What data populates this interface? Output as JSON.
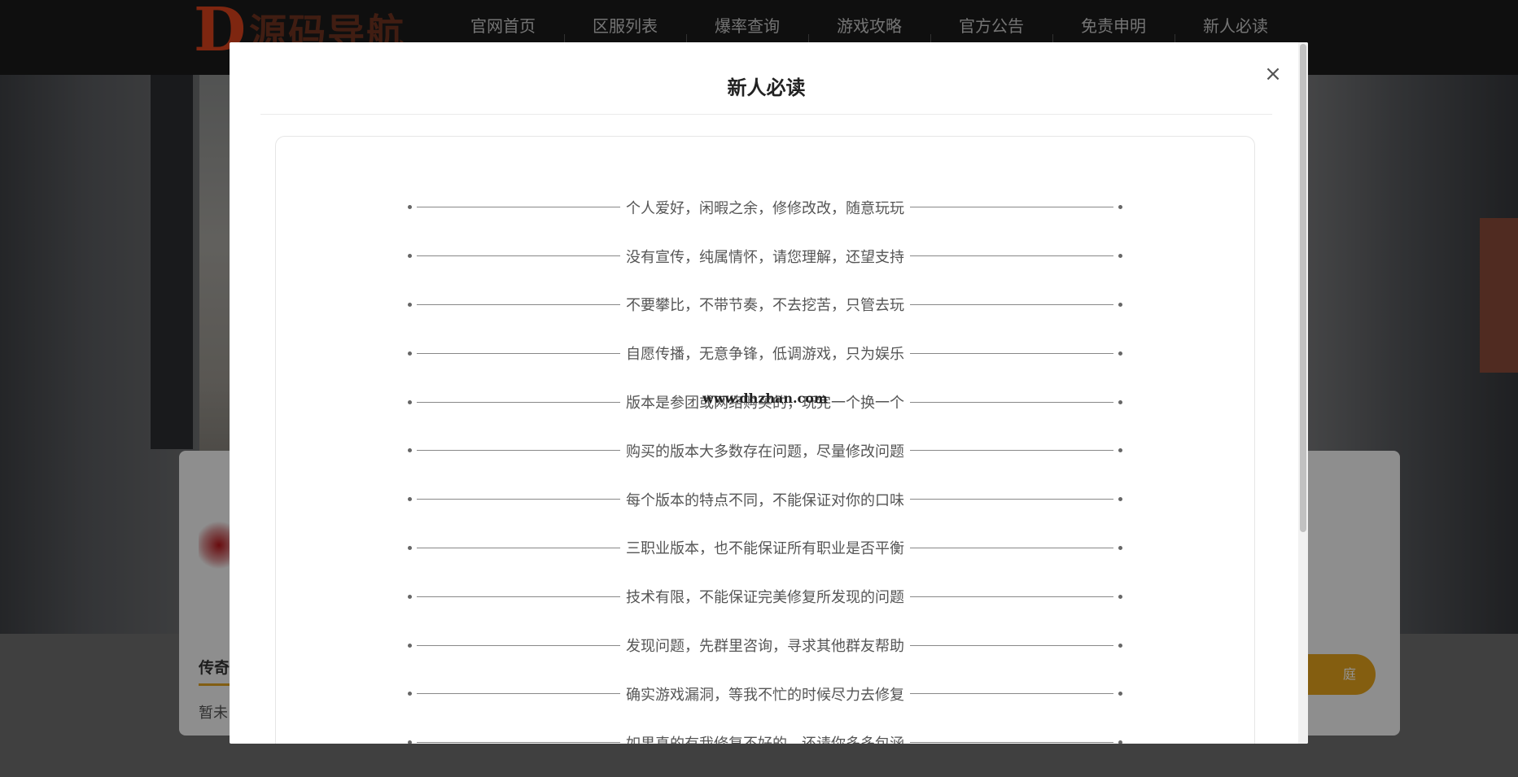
{
  "header": {
    "logo_letter": "D",
    "logo_text": "源码导航",
    "nav": [
      {
        "label": "官网首页",
        "sub": ""
      },
      {
        "label": "区服列表",
        "sub": ""
      },
      {
        "label": "爆率查询",
        "sub": ""
      },
      {
        "label": "游戏攻略",
        "sub": ""
      },
      {
        "label": "官方公告",
        "sub": ""
      },
      {
        "label": "免责申明",
        "sub": ""
      },
      {
        "label": "新人必读",
        "sub": ""
      }
    ]
  },
  "background": {
    "section_title": "传奇",
    "section_text": "暂未",
    "button_label": "庭"
  },
  "modal": {
    "title": "新人必读",
    "close_label": "×",
    "watermark": "www.dhzhan.com",
    "lines": [
      "个人爱好，闲暇之余，修修改改，随意玩玩",
      "没有宣传，纯属情怀，请您理解，还望支持",
      "不要攀比，不带节奏，不去挖苦，只管去玩",
      "自愿传播，无意争锋，低调游戏，只为娱乐",
      "版本是参团或网络购买的，玩完一个换一个",
      "购买的版本大多数存在问题，尽量修改问题",
      "每个版本的特点不同，不能保证对你的口味",
      "三职业版本，也不能保证所有职业是否平衡",
      "技术有限，不能保证完美修复所发现的问题",
      "发现问题，先群里咨询，寻求其他群友帮助",
      "确实游戏漏洞，等我不忙的时候尽力去修复",
      "如果真的有我修复不好的，还请你多多包涵"
    ]
  },
  "colors": {
    "accent": "#e3a21c",
    "logo": "#d9431c"
  }
}
